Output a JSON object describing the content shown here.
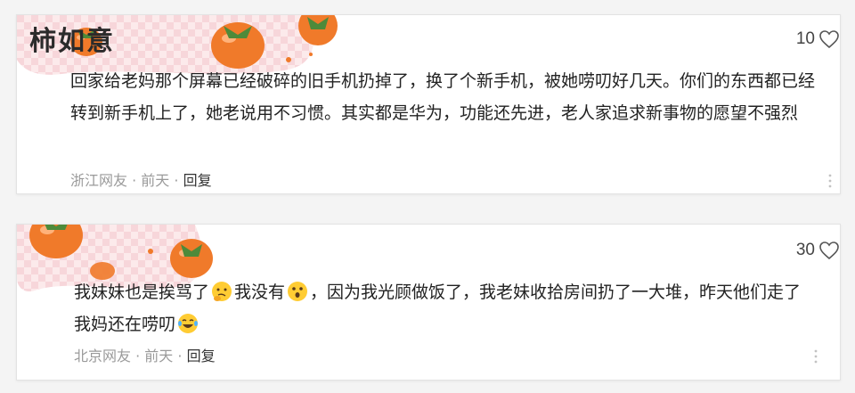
{
  "comments": [
    {
      "sticker_text": "柿如意",
      "likes": "10",
      "body": "回家给老妈那个屏幕已经破碎的旧手机扔掉了，换了个新手机，被她唠叨好几天。你们的东西都已经转到新手机上了，她老说用不习惯。其实都是华为，功能还先进，老人家追求新事物的愿望不强烈",
      "location": "浙江网友",
      "time": "前天",
      "sep": "·",
      "reply_label": "回复"
    },
    {
      "likes": "30",
      "body_parts": [
        "我妹妹也是挨骂了",
        "我没有",
        "，因为我光顾做饭了，我老妹收拾房间扔了一大堆，昨天他们走了我妈还在唠叨"
      ],
      "emojis": [
        "thinking-face-emoji",
        "hushed-face-emoji",
        "laughing-tears-emoji"
      ],
      "location": "北京网友",
      "time": "前天",
      "sep": "·",
      "reply_label": "回复"
    }
  ],
  "colors": {
    "persimmon": "#f07a2a",
    "leaf": "#4e8a3a",
    "pink_check": "#f6d3d7",
    "meta_gray": "#9a9a9a"
  },
  "icons": [
    "heart-outline-icon",
    "more-vertical-icon",
    "persimmon-sticker"
  ]
}
